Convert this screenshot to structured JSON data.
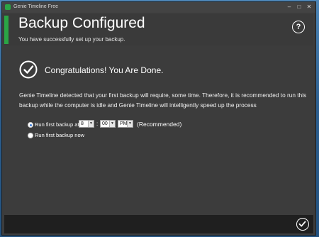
{
  "window": {
    "title": "Genie Timeline Free",
    "controls": {
      "minimize": "–",
      "maximize": "□",
      "close": "✕"
    }
  },
  "header": {
    "title": "Backup Configured",
    "subtitle": "You have successfully set up your backup.",
    "help_label": "?",
    "accent_color": "#2aa545"
  },
  "congrats": {
    "text": "Congratulations! You Are Done.",
    "icon": "check-circle-icon"
  },
  "description": "Genie Timeline detected that your first backup will require, some time. Therefore, it is recommended to run this backup while the computer is idle and Genie Timeline will intelligently speed up the process",
  "options": {
    "scheduled": {
      "label": "Run first backup at:",
      "selected": true,
      "hour": "8",
      "minute": "00",
      "ampm": "PM",
      "colon": ":",
      "note": "(Recommended)"
    },
    "now": {
      "label": "Run first backup now",
      "selected": false
    }
  },
  "footer": {
    "done_icon": "check-icon"
  }
}
